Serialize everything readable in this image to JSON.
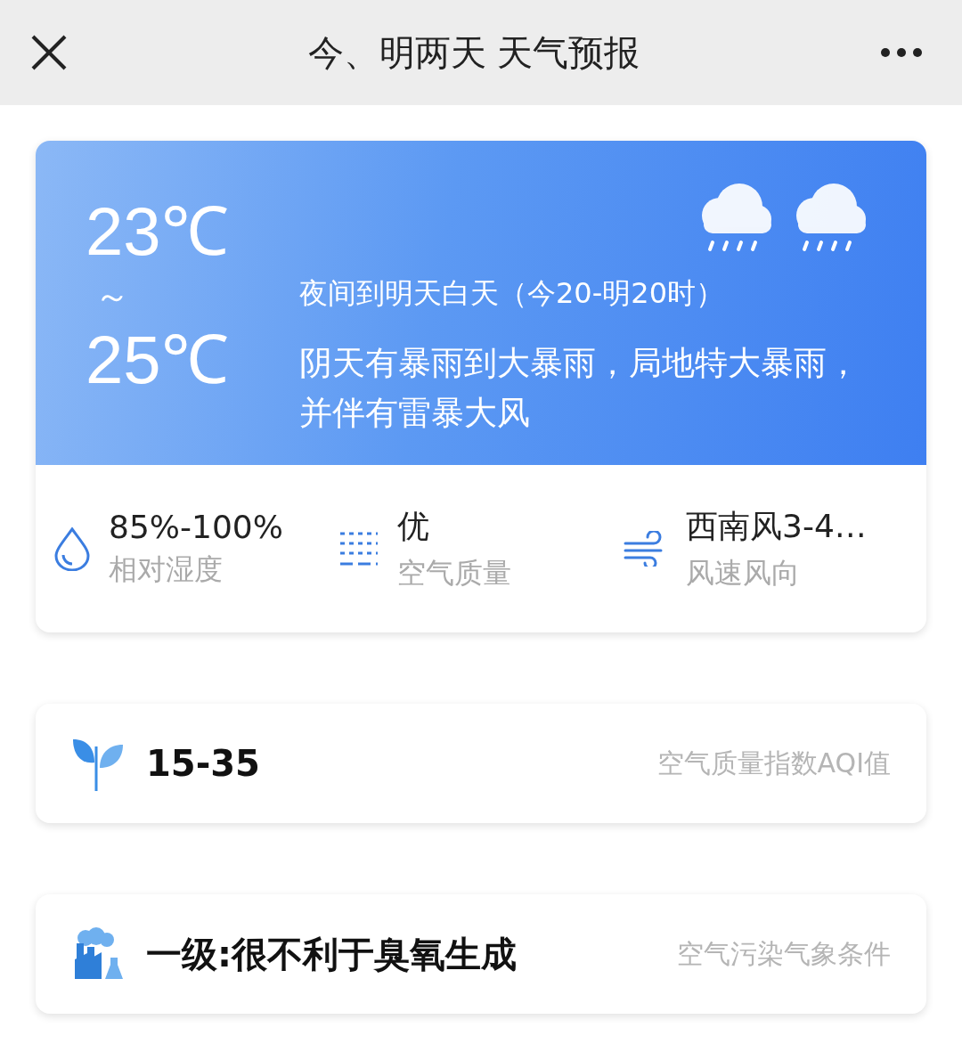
{
  "header": {
    "title": "今、明两天 天气预报"
  },
  "forecast": {
    "temp_low": "23℃",
    "separator": "～",
    "temp_high": "25℃",
    "period": "夜间到明天白天（今20-明20时）",
    "description": "阴天有暴雨到大暴雨，局地特大暴雨，并伴有雷暴大风",
    "details": [
      {
        "kind": "humidity",
        "value": "85%-100%",
        "label": "相对湿度"
      },
      {
        "kind": "air",
        "value": "优",
        "label": "空气质量"
      },
      {
        "kind": "wind",
        "value": "西南风3-4…",
        "label": "风速风向"
      }
    ]
  },
  "cards": [
    {
      "kind": "aqi",
      "value": "15-35",
      "label": "空气质量指数AQI值"
    },
    {
      "kind": "pollution",
      "value": "一级:很不利于臭氧生成",
      "label": "空气污染气象条件"
    }
  ]
}
